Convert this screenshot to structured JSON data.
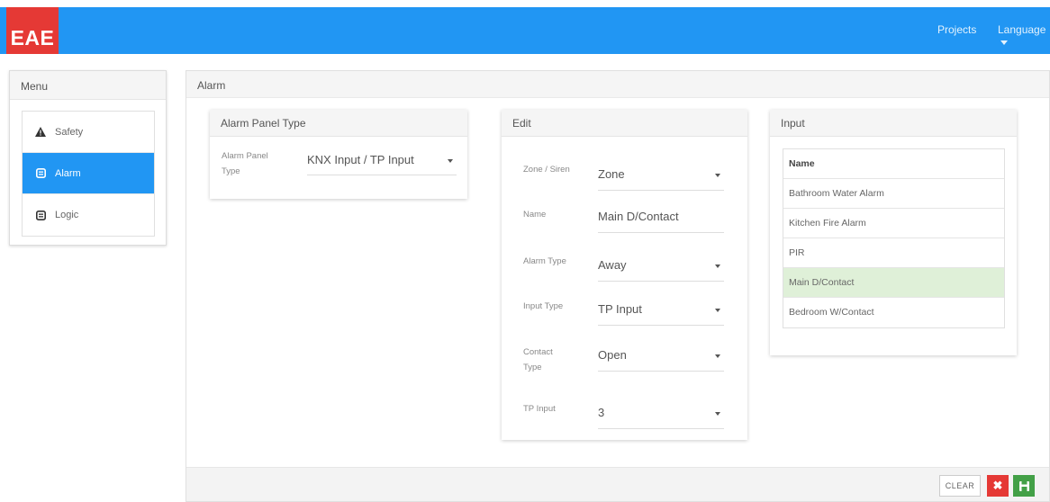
{
  "header": {
    "logo": "EAE",
    "nav_projects": "Projects",
    "nav_language": "Language"
  },
  "menu": {
    "title": "Menu",
    "items": [
      {
        "label": "Safety",
        "icon": "warning-icon",
        "active": false
      },
      {
        "label": "Alarm",
        "icon": "alarm-icon",
        "active": true
      },
      {
        "label": "Logic",
        "icon": "logic-icon",
        "active": false
      }
    ]
  },
  "main": {
    "title": "Alarm"
  },
  "alarm_panel_type": {
    "title": "Alarm Panel Type",
    "label": "Alarm Panel Type",
    "value": "KNX Input / TP Input"
  },
  "edit": {
    "title": "Edit",
    "zone_siren": {
      "label": "Zone / Siren",
      "value": "Zone"
    },
    "name": {
      "label": "Name",
      "value": "Main D/Contact"
    },
    "alarm_type": {
      "label": "Alarm Type",
      "value": "Away"
    },
    "input_type": {
      "label": "Input Type",
      "value": "TP Input"
    },
    "contact_type": {
      "label": "Contact Type",
      "value": "Open"
    },
    "tp_input": {
      "label": "TP Input",
      "value": "3"
    }
  },
  "input": {
    "title": "Input",
    "column_header": "Name",
    "rows": [
      "Bathroom Water Alarm",
      "Kitchen Fire Alarm",
      "PIR",
      "Main D/Contact",
      "Bedroom W/Contact"
    ],
    "selected_index": 3
  },
  "footer": {
    "clear_label": "CLEAR"
  },
  "colors": {
    "primary": "#2196f3",
    "logo_bg": "#e53935",
    "cancel": "#e53935",
    "save": "#43a047",
    "selected_row": "#dff0d8"
  }
}
